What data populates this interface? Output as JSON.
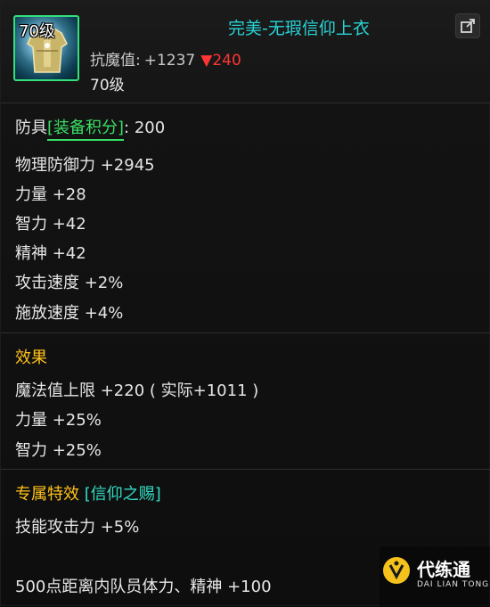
{
  "item": {
    "level_badge": "70级",
    "name": "完美-无瑕信仰上衣",
    "resist_label": "抗魔值:",
    "resist_value": "+1237",
    "resist_diff_arrow": "▼",
    "resist_diff": "240",
    "level": "70级"
  },
  "stats": {
    "armor_type": "防具",
    "gear_score_label": "[装备积分]",
    "gear_score_value": ": 200",
    "lines": [
      "物理防御力 +2945",
      "力量 +28",
      "智力 +42",
      "精神 +42",
      "攻击速度 +2%",
      "施放速度 +4%"
    ]
  },
  "effects": {
    "title": "效果",
    "lines": [
      "魔法值上限 +220 ( 实际+1011 )",
      "力量 +25%",
      "智力 +25%"
    ]
  },
  "exclusive": {
    "title": "专属特效",
    "link": "[信仰之赐]",
    "lines": [
      "技能攻击力 +5%",
      "500点距离内队员体力、精神 +100"
    ]
  },
  "watermark": {
    "title": "代练通",
    "subtitle": "DAI LIAN TONG"
  },
  "icons": {
    "share": "share-icon",
    "item": "armor-icon"
  },
  "colors": {
    "name_cyan": "#29d3d6",
    "section_gold": "#ffc21a",
    "link_green": "#39df64",
    "link_cyan": "#33dcc4",
    "diff_red": "#ff3535",
    "icon_border": "#33e07a"
  }
}
